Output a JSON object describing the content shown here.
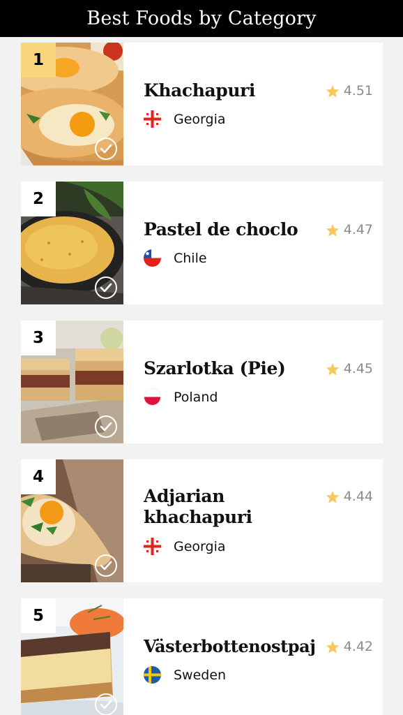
{
  "header": {
    "title": "Best Foods by Category"
  },
  "items": [
    {
      "rank": "1",
      "name": "Khachapuri",
      "country": "Georgia",
      "rating": "4.51",
      "flag": "georgia-flag-icon",
      "image": "khachapuri-photo"
    },
    {
      "rank": "2",
      "name": "Pastel de choclo",
      "country": "Chile",
      "rating": "4.47",
      "flag": "chile-flag-icon",
      "image": "pastel-de-choclo-photo"
    },
    {
      "rank": "3",
      "name": "Szarlotka (Pie)",
      "country": "Poland",
      "rating": "4.45",
      "flag": "poland-flag-icon",
      "image": "szarlotka-photo"
    },
    {
      "rank": "4",
      "name": "Adjarian khachapuri",
      "country": "Georgia",
      "rating": "4.44",
      "flag": "georgia-flag-icon",
      "image": "adjarian-khachapuri-photo"
    },
    {
      "rank": "5",
      "name": "Västerbottenostpaj",
      "country": "Sweden",
      "rating": "4.42",
      "flag": "sweden-flag-icon",
      "image": "vasterbottenostpaj-photo"
    }
  ],
  "colors": {
    "header_bg": "#000000",
    "rank_highlight": "#f8d47a",
    "star": "#f5c95c",
    "card_bg": "#ffffff",
    "page_bg": "#f2f2f3"
  },
  "icons": {
    "rating": "star-icon",
    "eaten_toggle": "checkmark-circle-icon"
  }
}
